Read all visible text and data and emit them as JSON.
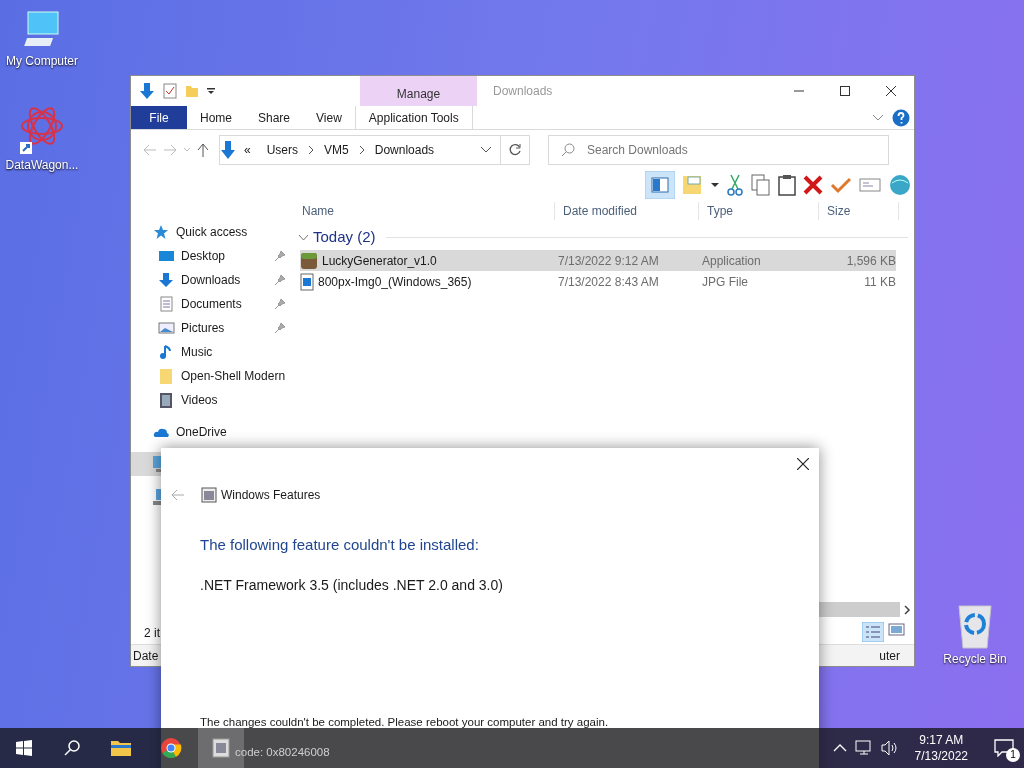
{
  "desktop_icons": [
    {
      "label": "My Computer",
      "kind": "computer"
    },
    {
      "label": "DataWagon...",
      "kind": "app"
    },
    {
      "label": "Recycle Bin",
      "kind": "recycle"
    }
  ],
  "explorer": {
    "title": "Downloads",
    "context_group": "Manage",
    "ribbon_tabs": [
      {
        "label": "File",
        "kind": "file"
      },
      {
        "label": "Home",
        "kind": "normal"
      },
      {
        "label": "Share",
        "kind": "normal"
      },
      {
        "label": "View",
        "kind": "normal"
      },
      {
        "label": "Application Tools",
        "kind": "context"
      }
    ],
    "address": {
      "overflow_mark": "«",
      "crumbs": [
        "Users",
        "VM5",
        "Downloads"
      ]
    },
    "search": {
      "placeholder": "Search Downloads"
    },
    "columns": [
      "Name",
      "Date modified",
      "Type",
      "Size"
    ],
    "nav": [
      {
        "label": "Quick access",
        "kind": "star",
        "pinned": false,
        "selected": false
      },
      {
        "label": "Desktop",
        "kind": "desktop",
        "pinned": true,
        "selected": false
      },
      {
        "label": "Downloads",
        "kind": "download",
        "pinned": true,
        "selected": false
      },
      {
        "label": "Documents",
        "kind": "document",
        "pinned": true,
        "selected": false
      },
      {
        "label": "Pictures",
        "kind": "picture",
        "pinned": true,
        "selected": false
      },
      {
        "label": "Music",
        "kind": "music",
        "pinned": false,
        "selected": false
      },
      {
        "label": "Open-Shell Modern",
        "kind": "folder",
        "pinned": false,
        "selected": false
      },
      {
        "label": "Videos",
        "kind": "video",
        "pinned": false,
        "selected": false
      },
      {
        "label": "OneDrive",
        "kind": "cloud",
        "pinned": false,
        "selected": false
      },
      {
        "kind": "pc",
        "selected": true
      },
      {
        "kind": "network",
        "selected": false
      }
    ],
    "groups": [
      {
        "label": "Today (2)",
        "files": [
          {
            "name": "LuckyGenerator_v1.0",
            "date": "7/13/2022 9:12 AM",
            "type": "Application",
            "size": "1,596 KB",
            "kind": "app",
            "selected": true
          },
          {
            "name": "800px-Img0_(Windows_365)",
            "date": "7/13/2022 8:43 AM",
            "type": "JPG File",
            "size": "11 KB",
            "kind": "image",
            "selected": false
          }
        ]
      }
    ],
    "status_bar": {
      "item_count": "2 it"
    },
    "details_bar": [
      "Date",
      "uter"
    ]
  },
  "dialog": {
    "title": "Windows Features",
    "heading": "The following feature couldn't be installed:",
    "feature": ".NET Framework 3.5 (includes .NET 2.0 and 3.0)",
    "message": "The changes couldn't be completed. Please reboot your computer and try again.",
    "error": "code: 0x80246008"
  },
  "taskbar": {
    "apps": [
      {
        "kind": "explorer",
        "active": false
      },
      {
        "kind": "chrome",
        "active": false
      },
      {
        "kind": "features",
        "active": true
      }
    ],
    "time": "9:17 AM",
    "date": "7/13/2022",
    "notification_count": "1"
  }
}
